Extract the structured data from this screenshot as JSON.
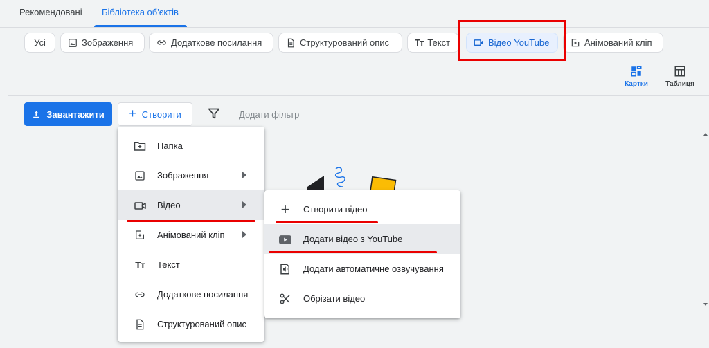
{
  "tabs": [
    {
      "label": "Рекомендовані",
      "active": false
    },
    {
      "label": "Бібліотека об'єктів",
      "active": true
    }
  ],
  "chips": [
    {
      "label": "Усі",
      "icon": "none"
    },
    {
      "label": "Зображення",
      "icon": "image-icon"
    },
    {
      "label": "Додаткове посилання",
      "icon": "link-icon"
    },
    {
      "label": "Структурований опис",
      "icon": "description-icon"
    },
    {
      "label": "Текст",
      "icon": "text-icon"
    },
    {
      "label": "Відео YouTube",
      "icon": "video-icon",
      "selected": true
    },
    {
      "label": "Анімований клiп",
      "icon": "animated-clip-icon"
    }
  ],
  "views": {
    "cards": "Картки",
    "table": "Таблиця",
    "active": "cards"
  },
  "toolbar": {
    "upload_label": "Завантажити",
    "create_label": "Створити",
    "add_filter_label": "Додати фільтр"
  },
  "create_menu": {
    "items": [
      {
        "label": "Папка",
        "icon": "folder-add-icon",
        "submenu": false
      },
      {
        "label": "Зображення",
        "icon": "image-icon",
        "submenu": true
      },
      {
        "label": "Відео",
        "icon": "video-icon",
        "submenu": true,
        "highlighted": true
      },
      {
        "label": "Анімований кліп",
        "icon": "animated-clip-icon",
        "submenu": true
      },
      {
        "label": "Текст",
        "icon": "text-icon",
        "submenu": false
      },
      {
        "label": "Додаткове посилання",
        "icon": "link-icon",
        "submenu": false
      },
      {
        "label": "Структурований опис",
        "icon": "description-icon",
        "submenu": false
      }
    ]
  },
  "video_submenu": {
    "items": [
      {
        "label": "Створити відео",
        "icon": "plus-icon"
      },
      {
        "label": "Додати відео з YouTube",
        "icon": "youtube-icon",
        "highlighted": true
      },
      {
        "label": "Додати автоматичне озвучування",
        "icon": "voiceover-icon"
      },
      {
        "label": "Обрізати відео",
        "icon": "scissors-icon"
      }
    ]
  },
  "colors": {
    "accent": "#1a73e8",
    "annotation": "#ea0000",
    "hover": "#e8eaed",
    "selected_chip": "#e8f0fe"
  }
}
